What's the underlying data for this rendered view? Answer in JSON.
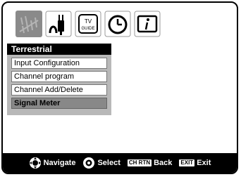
{
  "tabs": [
    {
      "icon": "antenna-icon"
    },
    {
      "icon": "plug-icon"
    },
    {
      "icon": "tv-guide-icon",
      "label_top": "TV",
      "label_bottom": "GUIDE"
    },
    {
      "icon": "clock-icon"
    },
    {
      "icon": "info-icon"
    }
  ],
  "menu": {
    "title": "Terrestrial",
    "items": [
      {
        "label": "Input Configuration"
      },
      {
        "label": "Channel program"
      },
      {
        "label": "Channel Add/Delete"
      },
      {
        "label": "Signal Meter"
      }
    ],
    "selected_index": 3
  },
  "footer": {
    "navigate_label": "Navigate",
    "select_label": "Select",
    "back_key": "CH RTN",
    "back_label": "Back",
    "exit_key": "EXIT",
    "exit_label": "Exit"
  },
  "colors": {
    "frame": "#000000",
    "active_tab": "#8a8a8a",
    "menu_bg": "#b8b8b8",
    "selected_item": "#888888"
  }
}
